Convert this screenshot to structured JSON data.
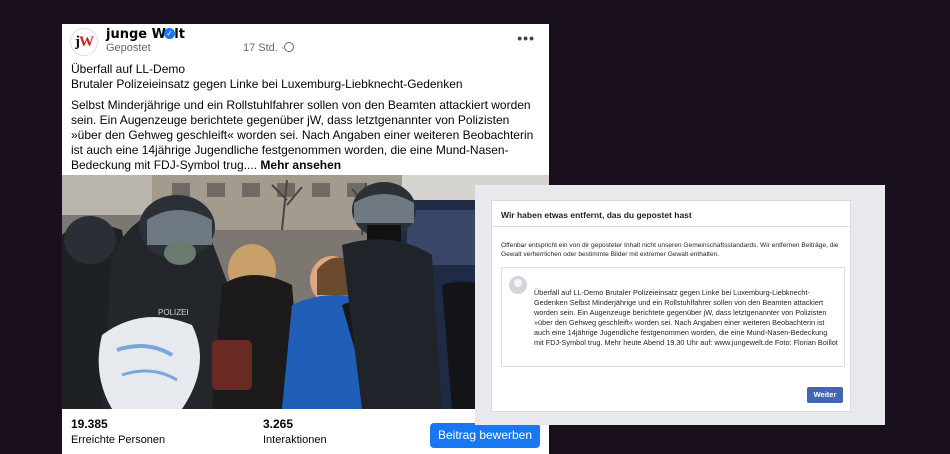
{
  "post": {
    "page_name": "junge Welt",
    "avatar_letters": {
      "j": "j",
      "w": "W"
    },
    "posted_label": "Gepostet",
    "time": "17 Std. ·",
    "icons": {
      "verified": "verified-badge-icon",
      "globe": "globe-icon",
      "more": "more-options-icon"
    },
    "title_line1": "Überfall auf LL-Demo",
    "title_line2": "Brutaler Polizeieinsatz gegen Linke bei Luxemburg-Liebknecht-Gedenken",
    "body": "Selbst Minderjährige und ein Rollstuhlfahrer sollen von den Beamten attackiert worden sein. Ein Augenzeuge berichtete gegenüber jW, dass letztgenannter von Polizisten »über den Gehweg geschleift« worden sei. Nach Angaben einer weiteren Beobachterin ist auch eine 14jährige Jugendliche festgenommen worden, die eine Mund-Nasen-Bedeckung mit FDJ-Symbol trug....",
    "see_more": "Mehr ansehen",
    "photo_sign_text": "POLIZEI",
    "stats": {
      "reach_value": "19.385",
      "reach_label": "Erreichte Personen",
      "interactions_value": "3.265",
      "interactions_label": "Interaktionen"
    },
    "boost_button": "Beitrag bewerben",
    "accent_color": "#1877f2"
  },
  "notice": {
    "title": "Wir haben etwas entfernt, das du gepostet hast",
    "description": "Offenbar entspricht ein von dir geposteter Inhalt nicht unseren Gemeinschaftsstandards. Wir entfernen Beiträge, die Gewalt verherrlichen oder bestimmte Bilder mit extremer Gewalt enthalten.",
    "quoted_post": "Überfall auf LL-Demo Brutaler Polizeieinsatz gegen Linke bei Luxemburg-Liebknecht-Gedenken Selbst Minderjährige und ein Rollstuhlfahrer sollen von den Beamten attackiert worden sein. Ein Augenzeuge berichtete gegenüber jW, dass letztgenannter von Polizisten »über den Gehweg geschleift« worden sei. Nach Angaben einer weiteren Beobachterin ist auch eine 14jährige Jugendliche festgenommen worden, die eine Mund-Nasen-Bedeckung mit FDJ-Symbol trug. Mehr heute Abend 19.30 Uhr auf: www.jungewelt.de Foto: Florian Boillot",
    "continue_button": "Weiter",
    "button_color": "#4267b2"
  }
}
